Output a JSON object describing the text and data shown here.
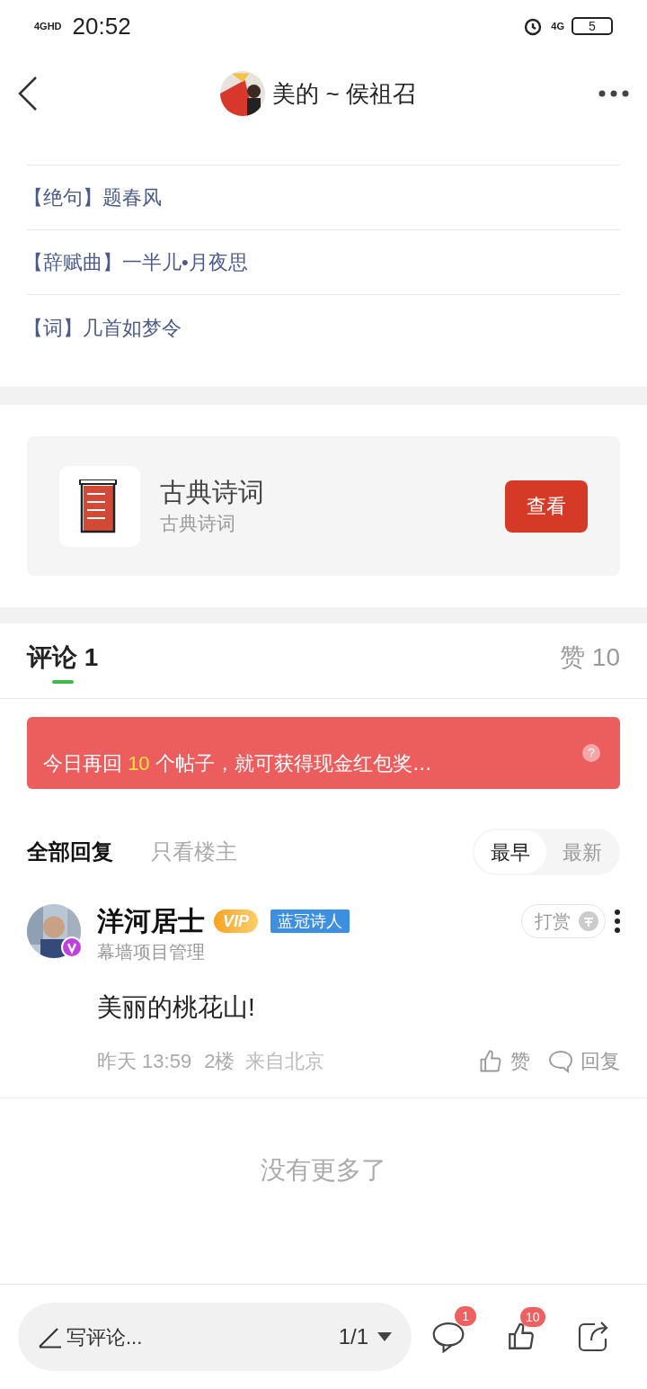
{
  "status_bar": {
    "network": "4GHD",
    "time": "20:52",
    "mobile": "4G",
    "battery": "5"
  },
  "header": {
    "title": "美的 ~ 侯祖召"
  },
  "articles": [
    "【绝句】题春风",
    "【辞赋曲】一半儿•月夜思",
    "【词】几首如梦令"
  ],
  "collection": {
    "title": "古典诗词",
    "subtitle": "古典诗词",
    "button": "查看"
  },
  "tabs": [
    {
      "label": "评论 1",
      "selected": true
    },
    {
      "label": "赞 10",
      "selected": false
    }
  ],
  "banner": {
    "before": "今日再回",
    "count": "10",
    "after": "个帖子，就可获得现金红包奖…",
    "help": "?"
  },
  "filters": [
    {
      "label": "全部回复",
      "selected": true
    },
    {
      "label": "只看楼主",
      "selected": false
    }
  ],
  "sort": [
    {
      "label": "最早",
      "selected": true
    },
    {
      "label": "最新",
      "selected": false
    }
  ],
  "comments": [
    {
      "name": "洋河居士",
      "vip": "VIP",
      "badge": "蓝冠诗人",
      "title": "幕墙项目管理",
      "reward": "打赏",
      "text": "美丽的桃花山!",
      "time": "昨天 13:59",
      "floor": "2楼",
      "location": "来自北京",
      "like": "赞",
      "reply": "回复"
    }
  ],
  "end_text": "没有更多了",
  "bottom_bar": {
    "placeholder": "写评论...",
    "page": "1/1",
    "comment_count": "1",
    "like_count": "10"
  }
}
